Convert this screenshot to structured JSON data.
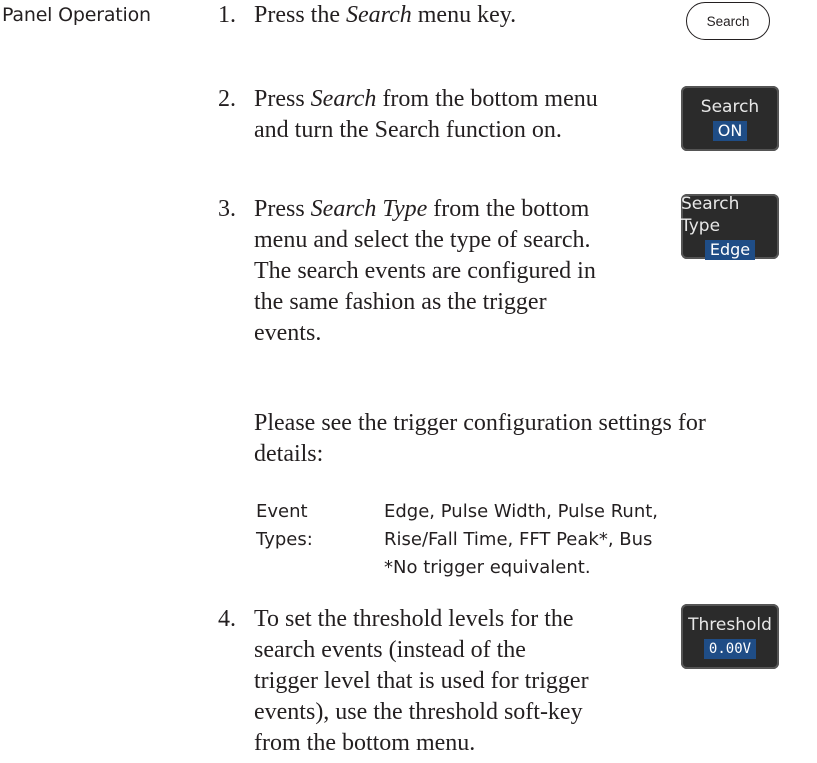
{
  "section_label": "Panel Operation",
  "steps": [
    {
      "number": "1.",
      "lines": [
        "Press the <i>Search</i> menu key."
      ]
    },
    {
      "number": "2.",
      "lines": [
        "Press <i>Search</i> from the bottom menu",
        "and turn the Search function on."
      ]
    },
    {
      "number": "3.",
      "lines": [
        "Press <i>Search Type</i> from the bottom",
        "menu and select the type of search.",
        "The search events are configured in",
        "the same fashion as the trigger",
        "events."
      ]
    },
    {
      "number": "4.",
      "lines": [
        "To set the threshold levels for the",
        "search events (instead of the",
        "trigger level that is used for trigger",
        "events), use the threshold soft-key",
        "from the bottom menu."
      ]
    }
  ],
  "note_lines": [
    "Please see the trigger configuration settings for",
    "details:"
  ],
  "event_types": {
    "label_line1": "Event",
    "label_line2": "Types:",
    "value_line1": "Edge, Pulse Width, Pulse Runt,",
    "value_line2": "Rise/Fall Time, FFT Peak*, Bus",
    "footnote": "*No trigger equivalent."
  },
  "keys": {
    "search_menu_key": "Search",
    "search_softkey": {
      "title": "Search",
      "value": "ON"
    },
    "search_type_softkey": {
      "title": "Search Type",
      "value": "Edge"
    },
    "threshold_softkey": {
      "title": "Threshold",
      "value": "0.00V"
    }
  },
  "colors": {
    "softkey_bg": "#2b2b2b",
    "softkey_highlight": "#1f4d86",
    "text": "#231f20"
  }
}
